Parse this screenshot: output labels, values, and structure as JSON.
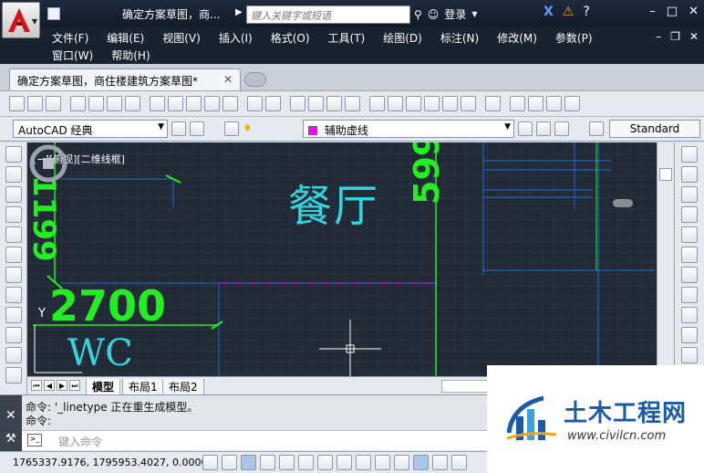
{
  "titlebar": {
    "title": "确定方案草图，商...",
    "search_placeholder": "键入关键字或短语",
    "login_label": "登录"
  },
  "menu": {
    "items_row1": [
      "文件(F)",
      "编辑(E)",
      "视图(V)",
      "插入(I)",
      "格式(O)",
      "工具(T)",
      "绘图(D)",
      "标注(N)",
      "修改(M)",
      "参数(P)"
    ],
    "items_row2": [
      "窗口(W)",
      "帮助(H)"
    ]
  },
  "doc_tab": {
    "label": "确定方案草图，商住楼建筑方案草图*",
    "close": "✕"
  },
  "toolbar": {
    "workspace": "AutoCAD 经典",
    "layer": "辅助虚线",
    "text_style": "Standard",
    "layer_color": "#ff00ff"
  },
  "drawing": {
    "viewport_label": "[−][俯视][二维线框]",
    "room_label": "餐厅",
    "dim_2700": "2700",
    "dim_599": "599",
    "dim_1199": "1199",
    "wc_label": "WC",
    "ucs_axis": "Y"
  },
  "layout_tabs": [
    "模型",
    "布局1",
    "布局2"
  ],
  "command": {
    "line1": "命令: '_linetype 正在重生成模型。",
    "line2": "命令:",
    "placeholder": "键入命令"
  },
  "status": {
    "coords": "1765337.9176, 1795953.4027, 0.0000"
  },
  "watermark": {
    "title": "土木工程网",
    "url": "www.civilcn.com"
  },
  "colors": {
    "canvas_bg": "#222a36",
    "dim_green": "#22ee22",
    "text_cyan": "#34d3de",
    "line_blue": "#1e6fd6",
    "magenta": "#ff00ff"
  }
}
